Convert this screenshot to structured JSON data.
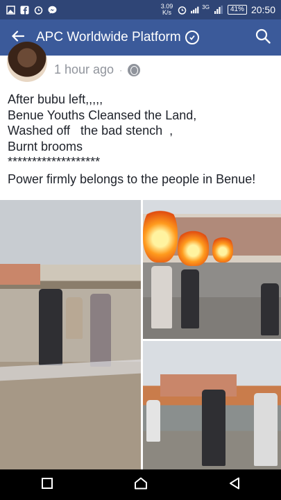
{
  "status_bar": {
    "net_speed_value": "3.09",
    "net_speed_unit": "K/s",
    "network_type": "3G",
    "battery": "41%",
    "time": "20:50"
  },
  "app_bar": {
    "title": "APC Worldwide Platform"
  },
  "post": {
    "time_ago": "1 hour ago",
    "separator": "·",
    "privacy_icon": "globe-icon",
    "lines": [
      "After bubu left,,,,,",
      "Benue Youths Cleansed the Land,",
      "Washed off   the bad stench  ,",
      "Burnt brooms",
      "*******************",
      "Power firmly belongs to the people in Benue!"
    ]
  },
  "colors": {
    "status_bar": "#2f4576",
    "app_bar": "#3b5a9a",
    "time_text": "#90949c",
    "post_text": "#1d2129"
  }
}
